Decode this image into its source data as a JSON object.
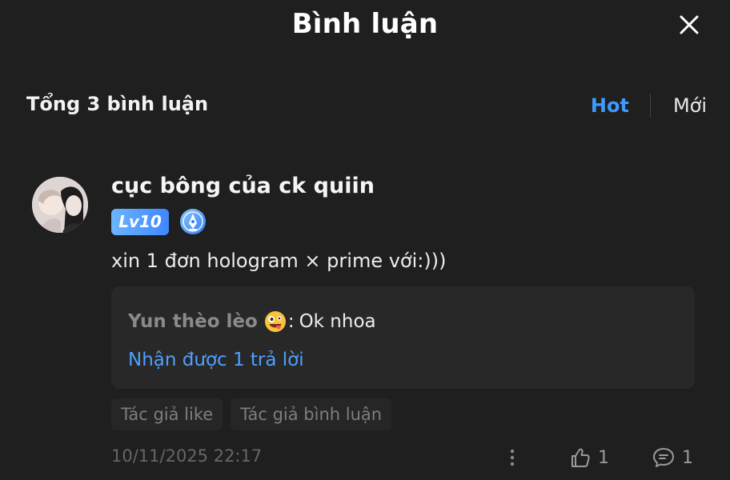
{
  "header": {
    "title": "Bình luận"
  },
  "summary": {
    "title": "Tổng 3 bình luận",
    "sort_hot": "Hot",
    "sort_new": "Mới"
  },
  "comment": {
    "username": "cục bông của ck quiin",
    "level": "Lv10",
    "text": "xin 1 đơn hologram × prime với:)))",
    "reply": {
      "author": "Yun thèo lèo",
      "separator": ":",
      "body": "Ok nhoa",
      "count_text": "Nhận được 1 trả lời"
    },
    "tags": [
      "Tác giả like",
      "Tác giả bình luận"
    ],
    "timestamp": "10/11/2025 22:17",
    "like_count": "1",
    "reply_total": "1"
  }
}
